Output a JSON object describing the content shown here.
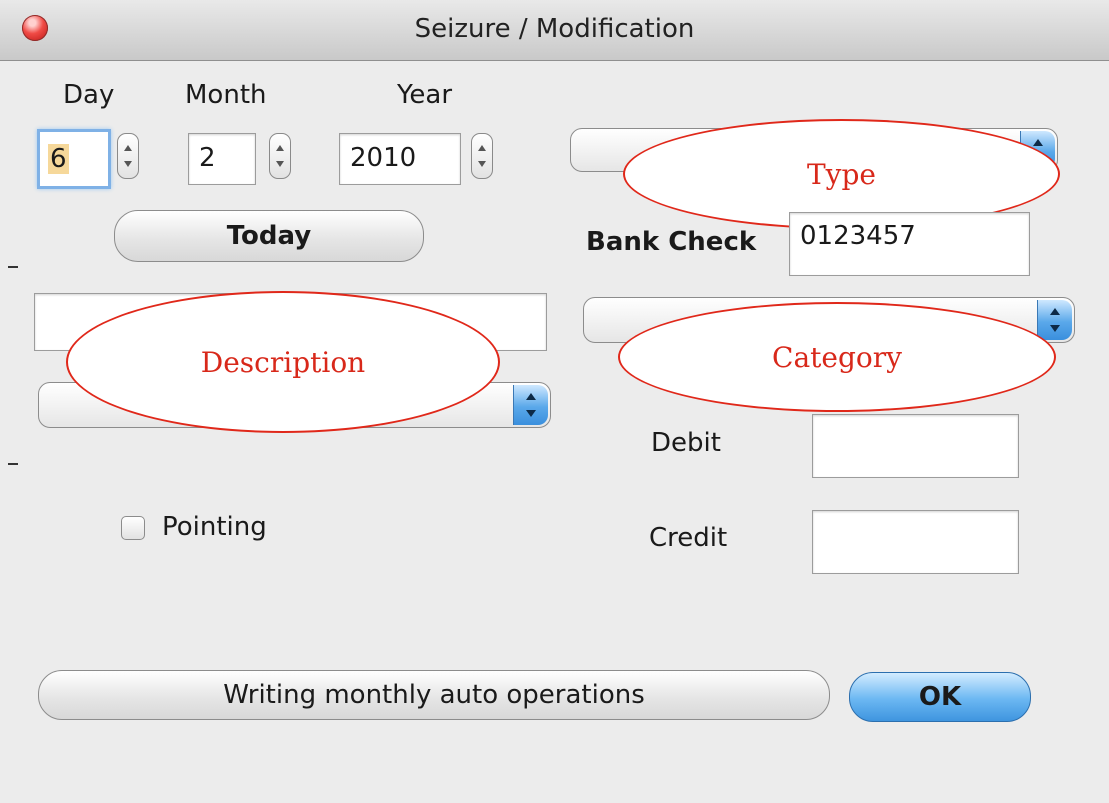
{
  "window": {
    "title": "Seizure / Modification"
  },
  "date": {
    "day_label": "Day",
    "month_label": "Month",
    "year_label": "Year",
    "day_value": "6",
    "month_value": "2",
    "year_value": "2010",
    "today_button": "Today"
  },
  "type": {
    "annotation": "Type"
  },
  "bank_check": {
    "label": "Bank Check",
    "value": "0123457"
  },
  "description": {
    "annotation": "Description",
    "value": ""
  },
  "category": {
    "annotation": "Category"
  },
  "amounts": {
    "debit_label": "Debit",
    "credit_label": "Credit",
    "debit_value": "",
    "credit_value": ""
  },
  "pointing": {
    "label": "Pointing",
    "checked": false
  },
  "footer": {
    "auto_ops_button": "Writing monthly auto operations",
    "ok_button": "OK"
  },
  "colors": {
    "annotation_red": "#d8281a",
    "default_button_blue": "#5aa8ea"
  }
}
